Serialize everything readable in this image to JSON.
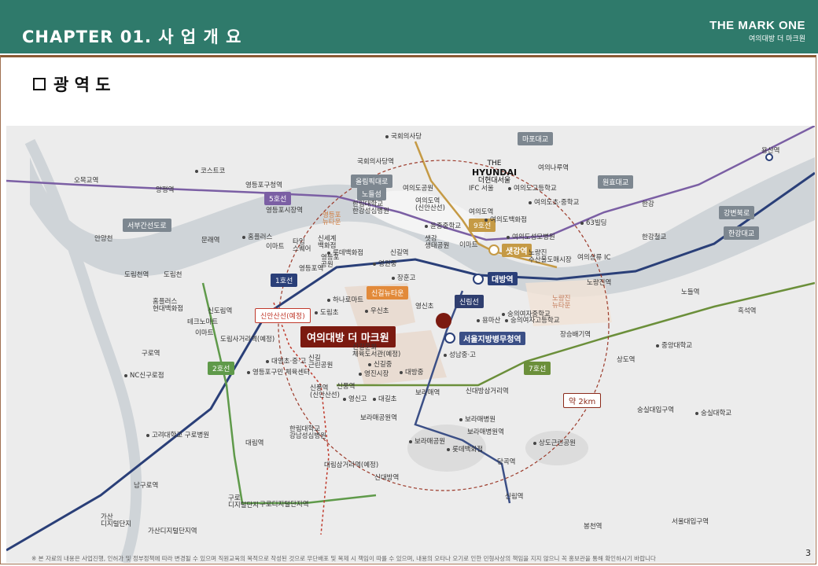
{
  "header": {
    "title": "CHAPTER  01.  사 업 개 요",
    "logo_main": "THE MARK ONE",
    "logo_sub": "여의대방 더 마크원"
  },
  "section": {
    "title": "광 역 도"
  },
  "site": {
    "name": "여의대방 더 마크원",
    "radius": "약 2km"
  },
  "badges": {
    "madae": "마포대교",
    "wonhyo": "원효대교",
    "gangbyeon": "강변북로",
    "hangang_bridge": "한강대교",
    "seobu": "서부간선도로",
    "olympic": "올림픽대로",
    "nodeulseom": "노들섬",
    "line5": "5호선",
    "line1": "1호선",
    "line2": "2호선",
    "line7": "7호선",
    "line9": "9호선",
    "shinansan": "신안산선(예정)",
    "shingil_nt": "신길뉴타운",
    "yeongdeungpo_nt": "영등포\n뉴타운",
    "sillim": "신림선"
  },
  "hyundai": {
    "name": "HYUNDAI",
    "pre": "THE",
    "sub": "더현대서울"
  },
  "stations": {
    "national_assembly_station": "국회의사당역",
    "national_assembly": "국회의사당",
    "yeouinaru": "여의나루역",
    "yeouido_park": "여의도공원",
    "yeouido_stn": "여의도역\n(신안산선)",
    "yeouido2": "여의도역",
    "saetgang": "샛강역",
    "daebang": "대방역",
    "noryangjin": "노량진역",
    "yongsan": "용산역",
    "ifc": "IFC 서울",
    "yeouido_hs": "여의도고등학교",
    "yeouido_ms": "여의도초·중학교",
    "yeouido_dept": "여의도백화점",
    "yeouido_hosp": "여의도성모병원",
    "bldg63": "63빌딩",
    "yonghwa": "윤중중학교",
    "saetgang_park": "샛강\n생태공원",
    "emart_y": "이마트",
    "noryangjin_market": "노량진\n수산물도매시장",
    "yeouisangryu": "여의상류 IC",
    "hangang": "한강",
    "hangang_park": "한강철교",
    "nodeul": "노들역",
    "heukseok": "흑석역",
    "omok": "오목교역",
    "yangpyeong": "양평역",
    "costco": "코스트코",
    "ydp_office": "영등포구청역",
    "ydp_market": "영등포시장역",
    "mullae": "문래역",
    "homeplus": "홈플러스",
    "emart": "이마트",
    "times": "타임\n스퀘어",
    "shinsegae": "신세계\n백화점",
    "lotte_ydp": "롯데백화점",
    "ydp_park": "영등포\n공원",
    "ydp": "영등포역",
    "yeongwon": "영원중",
    "shingil": "신길역",
    "hanrim": "한림대학교\n한강성심병원",
    "anyangcheon": "안양천",
    "dorimcheon_st": "도림천역",
    "dorimcheon": "도림천",
    "homeplus2": "홈플러스\n현대백화점",
    "techno": "테크노마트",
    "emart3": "이마트",
    "sindorim": "신도림역",
    "dorimsa": "도림사거리역(예정)",
    "hanaro": "하나로마트",
    "dorimgo": "도림초",
    "usin": "우신초",
    "janghun": "장훈고",
    "yeongsin": "영신초",
    "seoul_mma": "서울지방병무청역",
    "sungmoon": "숭의여자중학교",
    "sungmoon2": "숭의여자고등학교",
    "yongma": "용마산",
    "noryangjin_nt": "노량진\n뉴타운",
    "jangseungbaegi": "장승배기역",
    "sangdo": "상도역",
    "jungang_univ": "중앙대학교",
    "guro": "구로역",
    "nc": "NC신구로점",
    "daeyeong": "대영초·중·고",
    "shingil_park": "신길\n근린공원",
    "ydp_sports": "영등포구민 체육센터",
    "shingil_culture": "신길문화\n체육도서관(예정)",
    "shingil_ms": "신길중",
    "yeongjin": "영진시장",
    "daebang_ms": "대방중",
    "seongnam": "성남중·고",
    "shinpung": "신풍역",
    "shinpung2": "신풍역\n(신안산선)",
    "yeongsin_go": "영신고",
    "daegil": "대길초",
    "boramae": "보라매역",
    "sindaebang3": "신대방삼거리역",
    "soongsil": "숭실대입구역",
    "soongsil_univ": "숭실대학교",
    "boramae_park": "보라매공원역",
    "boramae_hosp": "보라매병원",
    "boramae_hosp_st": "보라매병원역",
    "boramae_pk": "보라매공원",
    "lotte_dept": "롯데백화점",
    "sangdo_park": "상도근린공원",
    "korea_univ": "고려대학교 구로병원",
    "hanrim_univ": "한림대학교\n강남성심병원",
    "daerim": "대림역",
    "daerimsam": "대림삼거리역(예정)",
    "dangok": "당곡역",
    "namguro": "남구로역",
    "guro_digital": "구로\n디지털단지",
    "guro_dig_st": "구로디지털단지역",
    "sindaebang": "신대방역",
    "sillim_st": "신림역",
    "gasan": "가산\n디지털단지",
    "gasan_st": "가산디지털단지역",
    "bongcheon": "봉천역",
    "seoul_univ": "서울대입구역"
  },
  "footnote": "※ 본 자료의 내용은 사업진행, 인허가 및 정부정책에 따라 변경될 수 있으며 직원교육의 목적으로 작성된 것으로 무단배포 및 복제 시 책임이 따를 수 있으며, 내용의 오타나 오기로 인한 민형사상의 책임을 지지 않으니 꼭 홍보관을 통해 확인하시기 바랍니다",
  "page": "3",
  "colors": {
    "header": "#2f7a6b",
    "site": "#7b1a10",
    "line1": "#2a3f78",
    "line2": "#5f9a4a",
    "line5": "#7b5fa4",
    "line7": "#6b8f3a",
    "line9": "#c59a45",
    "river": "#cfd4d8"
  }
}
